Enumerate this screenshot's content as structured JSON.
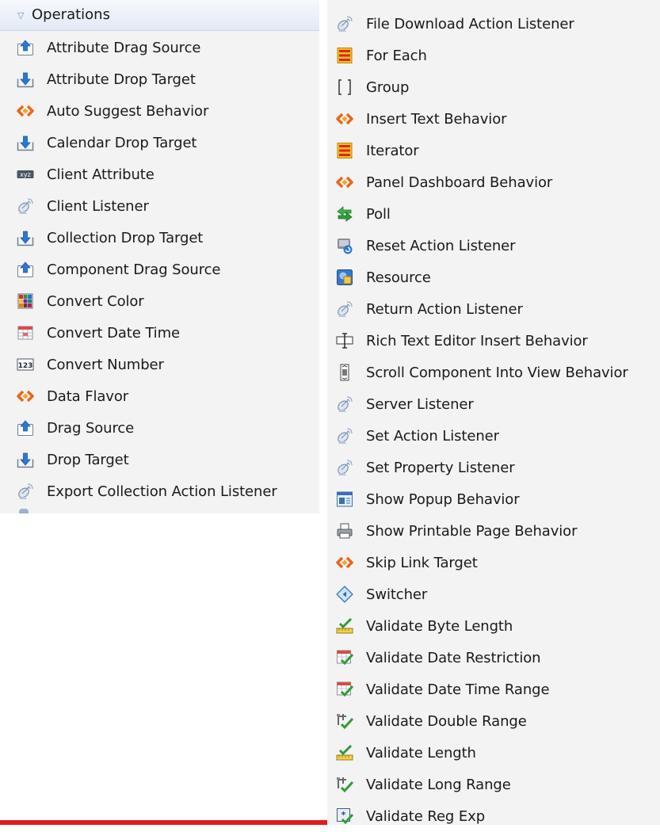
{
  "left": {
    "header": "Operations",
    "items": [
      {
        "label": "Attribute Drag Source",
        "icon": "upload-arrow-icon"
      },
      {
        "label": "Attribute Drop Target",
        "icon": "download-arrow-icon"
      },
      {
        "label": "Auto Suggest Behavior",
        "icon": "behavior-diamond-icon"
      },
      {
        "label": "Calendar Drop Target",
        "icon": "download-arrow-icon"
      },
      {
        "label": "Client Attribute",
        "icon": "xyz-attribute-icon"
      },
      {
        "label": "Client Listener",
        "icon": "satellite-listener-icon"
      },
      {
        "label": "Collection Drop Target",
        "icon": "download-arrow-icon"
      },
      {
        "label": "Component Drag Source",
        "icon": "upload-arrow-icon"
      },
      {
        "label": "Convert Color",
        "icon": "color-grid-icon"
      },
      {
        "label": "Convert Date Time",
        "icon": "calendar-grid-icon"
      },
      {
        "label": "Convert Number",
        "icon": "number-123-icon"
      },
      {
        "label": "Data Flavor",
        "icon": "behavior-diamond-icon"
      },
      {
        "label": "Drag Source",
        "icon": "upload-arrow-icon"
      },
      {
        "label": "Drop Target",
        "icon": "download-arrow-icon"
      },
      {
        "label": "Export Collection Action Listener",
        "icon": "satellite-listener-icon"
      }
    ]
  },
  "right": {
    "items": [
      {
        "label": "File Download Action Listener",
        "icon": "satellite-listener-icon"
      },
      {
        "label": "For Each",
        "icon": "iterator-list-icon"
      },
      {
        "label": "Group",
        "icon": "group-bracket-icon"
      },
      {
        "label": "Insert Text Behavior",
        "icon": "behavior-diamond-icon"
      },
      {
        "label": "Iterator",
        "icon": "iterator-list-icon"
      },
      {
        "label": "Panel Dashboard Behavior",
        "icon": "behavior-diamond-icon"
      },
      {
        "label": "Poll",
        "icon": "poll-arrows-icon"
      },
      {
        "label": "Reset Action Listener",
        "icon": "reset-action-icon"
      },
      {
        "label": "Resource",
        "icon": "resource-icon"
      },
      {
        "label": "Return Action Listener",
        "icon": "satellite-listener-icon"
      },
      {
        "label": "Rich Text Editor Insert Behavior",
        "icon": "text-cursor-icon"
      },
      {
        "label": "Scroll Component Into View Behavior",
        "icon": "scrollbar-icon"
      },
      {
        "label": "Server Listener",
        "icon": "satellite-listener-icon"
      },
      {
        "label": "Set Action Listener",
        "icon": "satellite-listener-icon"
      },
      {
        "label": "Set Property Listener",
        "icon": "satellite-listener-icon"
      },
      {
        "label": "Show Popup Behavior",
        "icon": "popup-window-icon"
      },
      {
        "label": "Show Printable Page Behavior",
        "icon": "printer-icon"
      },
      {
        "label": "Skip Link Target",
        "icon": "behavior-diamond-icon"
      },
      {
        "label": "Switcher",
        "icon": "switcher-diamond-icon"
      },
      {
        "label": "Validate Byte Length",
        "icon": "ruler-check-icon"
      },
      {
        "label": "Validate Date Restriction",
        "icon": "calendar-check-icon"
      },
      {
        "label": "Validate Date Time Range",
        "icon": "calendar-check-icon"
      },
      {
        "label": "Validate Double Range",
        "icon": "caliper-check-icon"
      },
      {
        "label": "Validate Length",
        "icon": "ruler-check-icon"
      },
      {
        "label": "Validate Long Range",
        "icon": "caliper-check-icon"
      },
      {
        "label": "Validate Reg Exp",
        "icon": "regex-check-icon"
      }
    ]
  },
  "colors": {
    "panel_bg": "#f3f3f3",
    "header_bg": "#e2eaf5",
    "accent_red": "#e21b1b",
    "icon_blue": "#2b78d4",
    "icon_orange": "#e8661c"
  }
}
